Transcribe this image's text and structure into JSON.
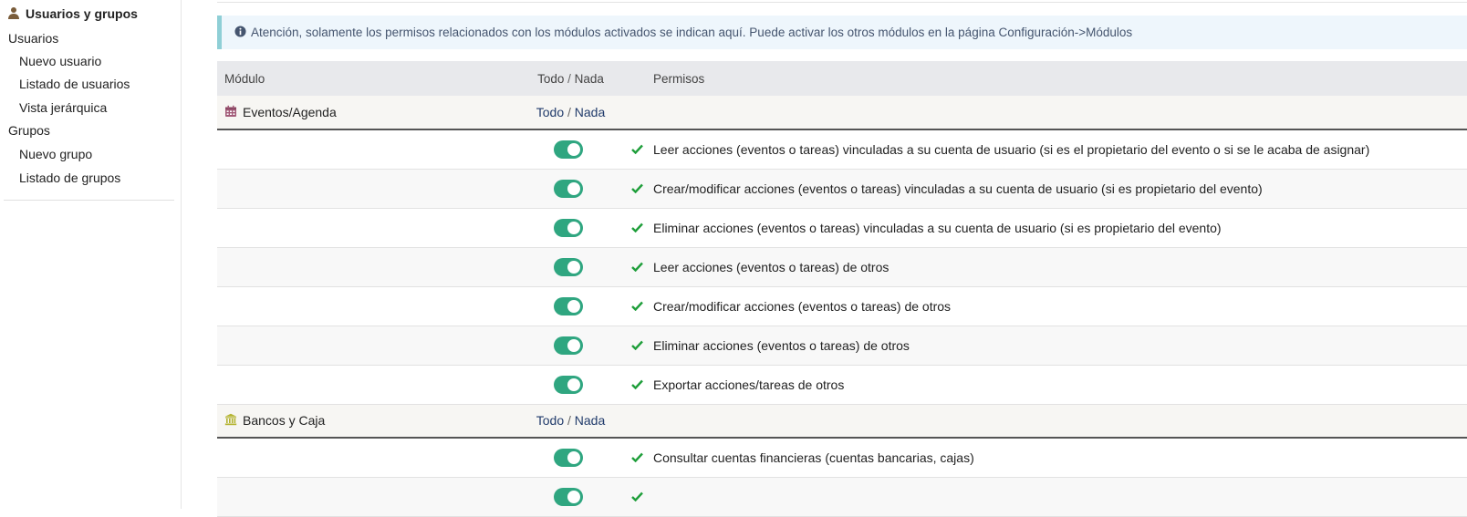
{
  "sidebar": {
    "title": "Usuarios y grupos",
    "title_icon": "user-icon",
    "items": [
      {
        "label": "Usuarios",
        "level": 1
      },
      {
        "label": "Nuevo usuario",
        "level": 2
      },
      {
        "label": "Listado de usuarios",
        "level": 2
      },
      {
        "label": "Vista jerárquica",
        "level": 2
      },
      {
        "label": "Grupos",
        "level": 1
      },
      {
        "label": "Nuevo grupo",
        "level": 2
      },
      {
        "label": "Listado de grupos",
        "level": 2
      }
    ]
  },
  "notice": {
    "icon": "info-circle-icon",
    "text": "Atención, solamente los permisos relacionados con los módulos activados se indican aquí. Puede activar los otros módulos en la página Configuración->Módulos"
  },
  "table": {
    "headers": {
      "module": "Módulo",
      "all": "Todo",
      "separator": "/",
      "none": "Nada",
      "permissions": "Permisos"
    },
    "modules": [
      {
        "name": "Eventos/Agenda",
        "icon": "calendar-icon",
        "icon_color": "#a25b78",
        "all": "Todo",
        "none": "Nada",
        "permissions": [
          {
            "label": "Leer acciones (eventos o tareas) vinculadas a su cuenta de usuario (si es el propietario del evento o si se le acaba de asignar)",
            "enabled": true
          },
          {
            "label": "Crear/modificar acciones (eventos o tareas) vinculadas a su cuenta de usuario (si es propietario del evento)",
            "enabled": true
          },
          {
            "label": "Eliminar acciones (eventos o tareas) vinculadas a su cuenta de usuario (si es propietario del evento)",
            "enabled": true
          },
          {
            "label": "Leer acciones (eventos o tareas) de otros",
            "enabled": true
          },
          {
            "label": "Crear/modificar acciones (eventos o tareas) de otros",
            "enabled": true
          },
          {
            "label": "Eliminar acciones (eventos o tareas) de otros",
            "enabled": true
          },
          {
            "label": "Exportar acciones/tareas de otros",
            "enabled": true
          }
        ]
      },
      {
        "name": "Bancos y Caja",
        "icon": "bank-icon",
        "icon_color": "#b3b32f",
        "all": "Todo",
        "none": "Nada",
        "permissions": [
          {
            "label": "Consultar cuentas financieras (cuentas bancarias, cajas)",
            "enabled": true
          },
          {
            "label": "",
            "enabled": true
          }
        ]
      }
    ]
  },
  "colors": {
    "toggle_on": "#2fa680",
    "check": "#1e9e3a",
    "link": "#213b6b",
    "notice_bg": "#eef6fc",
    "notice_border": "#8fcfd6"
  }
}
